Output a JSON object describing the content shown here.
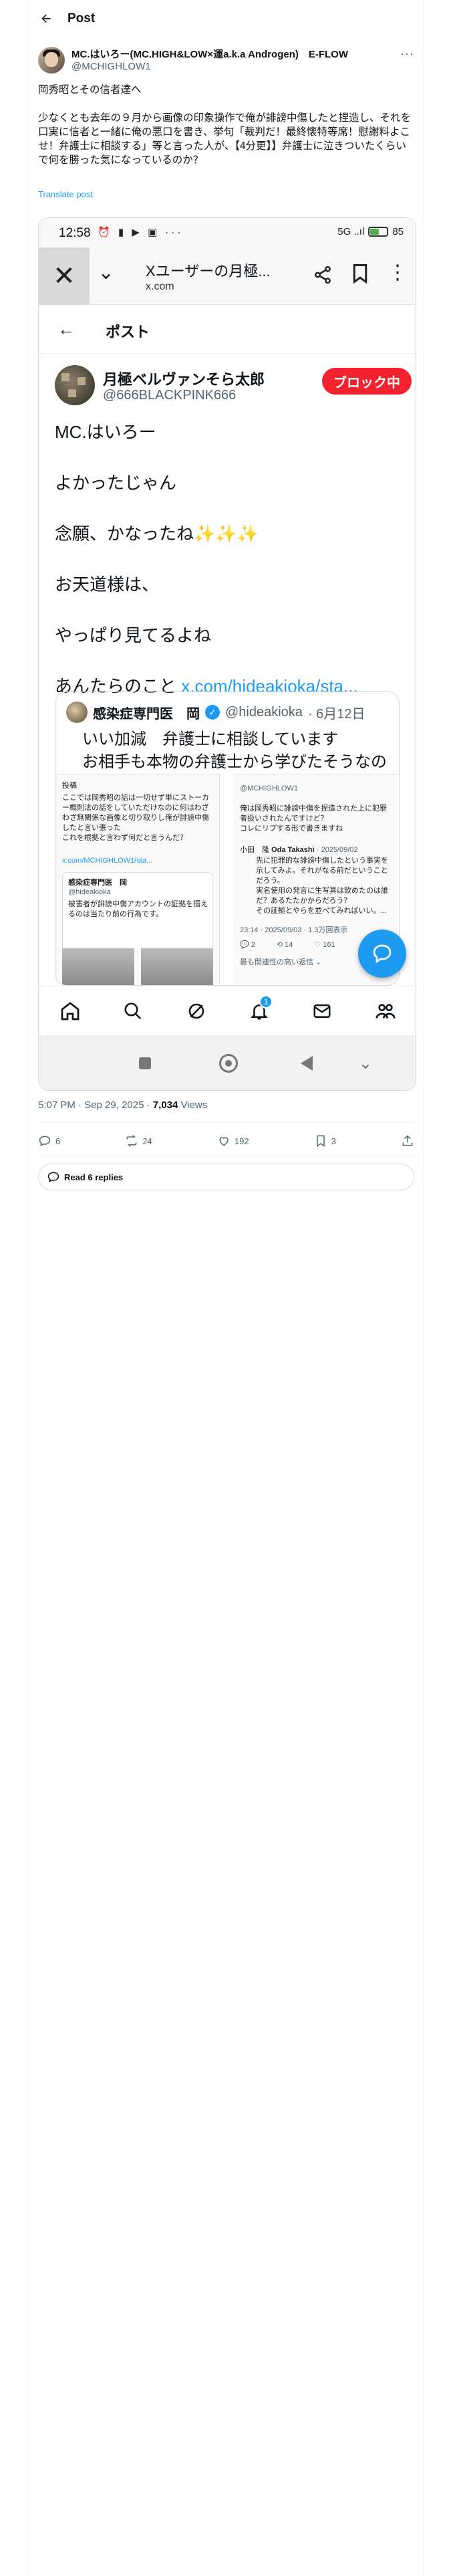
{
  "header": {
    "title": "Post"
  },
  "post": {
    "author_name": "MC.はいろー(MC.HIGH&LOW×運a.k.a Androgen)　E-FLOW",
    "author_handle": "@MCHIGHLOW1",
    "text": "岡秀昭とその信者達へ\n\n少なくとも去年の９月から画像の印象操作で俺が誹謗中傷したと捏造し、それを口実に信者と一緒に俺の悪口を書き、挙句「裁判だ！最終懐特等席！慰謝料よこせ！弁護士に相談する」等と言った人が、【4分更】】弁護士に泣きついたくらいで何を勝った気になっているのか？",
    "translate_label": "Translate post",
    "timestamp": "5:07 PM · Sep 29, 2025",
    "views_count": "7,034",
    "views_label": "Views",
    "replies_count": "6",
    "reposts_count": "24",
    "likes_count": "192",
    "bookmarks_count": "3",
    "read_replies_label": "Read 6 replies"
  },
  "screenshot": {
    "status_time": "12:58",
    "status_icons_left": "⏰ ▮ ▶ ▣ ···",
    "status_icons_right": "5G ..ıl",
    "battery_level": 0.55,
    "battery_label": "85",
    "browser_title": "Xユーザーの月極...",
    "browser_url": "x.com",
    "x_header_title": "ポスト",
    "inner_author_name": "月極ベルヴァンそら太郎",
    "inner_author_handle": "@666BLACKPINK666",
    "block_label": "ブロック中",
    "inner_lines": [
      "MC.はいろー",
      "よかったじゃん",
      "念願、かなったね✨✨✨",
      "お天道様は、",
      "やっぱり見てるよね"
    ],
    "inner_last_prefix": "あんたらのこと ",
    "inner_last_link": "x.com/hideakioka/sta...",
    "quote": {
      "name": "感染症専門医　岡",
      "handle": "@hideakioka",
      "date": "· 6月12日",
      "text": "いい加減　弁護士に相談しています\nお相手も本物の弁護士から学びたそうなので"
    },
    "shot_left": {
      "label": "投稿",
      "body": "ここでは岡秀昭の話は一切せず単にストーカー概則法の話をしていただけなのに何はわざわざ無関係な画像と切り取りし俺が誹謗中傷したと言い張った\nこれを根拠と言わず何だと言うんだ？",
      "link": "x.com/MCHIGHLOW1/sta...",
      "card_name": "感染症専門医　岡",
      "card_handle": "@hideakioka",
      "card_text": "被害者が誹謗中傷アカウントの証拠を掴えるのは当たり前の行為です。"
    },
    "shot_right": {
      "top_handle": "@MCHIGHLOW1",
      "body": "俺は岡秀昭に誹謗中傷を捏造された上に犯罪者扱いされたんですけど？\nコレにリプする形で書きますね",
      "reply_name": "小田　隆",
      "reply_handle": "Oda Takashi",
      "reply_date": "· 2025/09/02",
      "reply_text": "先に犯罪的な誹謗中傷したという事実を示してみよ。それがなる前だということだろう。\n実名使用の発言に生写真は飲めたのは誰だ？あるたたかからだろう？\nその証拠とやらを並べてみればいい。...",
      "mini_time": "23:14 · 2025/09/03 · 1.3万回表示",
      "mini_reply": "2",
      "mini_repost": "14",
      "mini_like": "161",
      "footer": "最も関連性の高い返信 ⌄"
    },
    "nav_badge": "1"
  }
}
